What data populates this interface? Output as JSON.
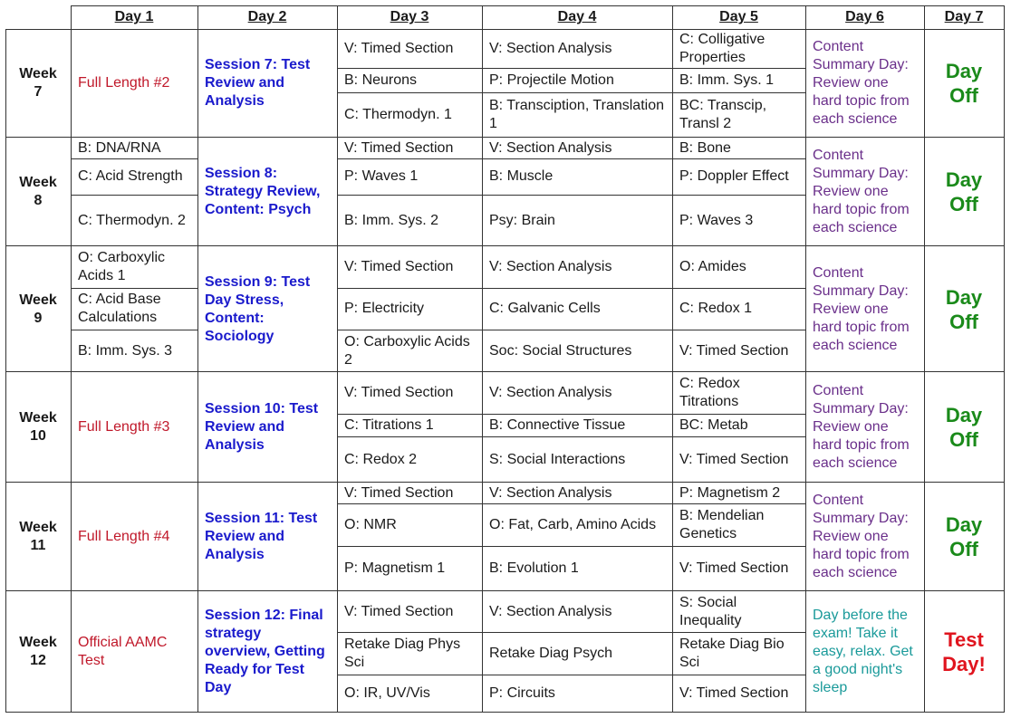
{
  "headers": [
    "Day 1",
    "Day 2",
    "Day 3",
    "Day 4",
    "Day 5",
    "Day 6",
    "Day 7"
  ],
  "weeks": [
    {
      "label": "Week\n7",
      "day1": [
        "Full Length #2"
      ],
      "day2": "Session 7: Test Review and Analysis",
      "day3": [
        "V: Timed Section",
        "B: Neurons",
        "C: Thermodyn. 1"
      ],
      "day4": [
        "V: Section Analysis",
        "P: Projectile Motion",
        "B: Transciption, Translation 1"
      ],
      "day5": [
        "C: Colligative Properties",
        "B: Imm. Sys. 1",
        "BC: Transcip, Transl 2"
      ],
      "day6": "Content Summary Day: Review one hard topic from each science",
      "day7": "Day Off"
    },
    {
      "label": "Week\n8",
      "day1": [
        "B: DNA/RNA",
        "C: Acid Strength",
        "C: Thermodyn. 2"
      ],
      "day2": "Session 8: Strategy Review, Content: Psych",
      "day3": [
        "V: Timed Section",
        "P: Waves 1",
        "B: Imm. Sys. 2"
      ],
      "day4": [
        "V: Section Analysis",
        "B: Muscle",
        "Psy: Brain"
      ],
      "day5": [
        "B: Bone",
        "P: Doppler Effect",
        "P: Waves 3"
      ],
      "day6": "Content Summary Day: Review one hard topic from each science",
      "day7": "Day Off"
    },
    {
      "label": "Week\n9",
      "day1": [
        "O: Carboxylic Acids 1",
        "C: Acid Base Calculations",
        "B: Imm. Sys. 3"
      ],
      "day2": "Session 9: Test Day Stress, Content: Sociology",
      "day3": [
        "V: Timed Section",
        "P: Electricity",
        "O: Carboxylic Acids 2"
      ],
      "day4": [
        "V: Section Analysis",
        "C: Galvanic Cells",
        "Soc: Social Structures"
      ],
      "day5": [
        "O: Amides",
        "C: Redox 1",
        "V: Timed Section"
      ],
      "day6": "Content Summary Day: Review one hard topic from each science",
      "day7": "Day Off"
    },
    {
      "label": "Week\n10",
      "day1": [
        "Full Length #3"
      ],
      "day2": "Session 10: Test Review and Analysis",
      "day3": [
        "V: Timed Section",
        "C: Titrations 1",
        "C: Redox 2"
      ],
      "day4": [
        "V: Section Analysis",
        "B: Connective Tissue",
        "S: Social Interactions"
      ],
      "day5": [
        "C: Redox Titrations",
        "BC: Metab",
        "V: Timed Section"
      ],
      "day6": "Content Summary Day: Review one hard topic from each science",
      "day7": "Day Off"
    },
    {
      "label": "Week\n11",
      "day1": [
        "Full Length #4"
      ],
      "day2": "Session 11: Test Review and Analysis",
      "day3": [
        "V: Timed Section",
        "O: NMR",
        "P: Magnetism 1"
      ],
      "day4": [
        "V: Section Analysis",
        "O: Fat, Carb, Amino Acids",
        "B: Evolution 1"
      ],
      "day5": [
        "P: Magnetism 2",
        "B: Mendelian Genetics",
        "V: Timed Section"
      ],
      "day6": "Content Summary Day: Review one hard topic from each science",
      "day7": "Day Off"
    },
    {
      "label": "Week\n12",
      "day1": [
        "Official AAMC Test"
      ],
      "day2": "Session 12: Final strategy overview, Getting Ready for Test Day",
      "day3": [
        "V: Timed Section",
        "Retake Diag Phys Sci",
        "O: IR, UV/Vis"
      ],
      "day4": [
        "V: Section Analysis",
        "Retake Diag Psych",
        "P: Circuits"
      ],
      "day5": [
        "S: Social Inequality",
        "Retake Diag Bio Sci",
        "V: Timed Section"
      ],
      "day6": "Day before the exam! Take it easy, relax. Get a good night's sleep",
      "day7": "Test Day!"
    }
  ],
  "colors": {
    "full_length": "#c0182a",
    "session": "#1a1acc",
    "content_summary": "#6a2f8a",
    "day_before": "#1a9a9a",
    "day_off": "#1a8a1a",
    "test_day": "#e0141e"
  }
}
